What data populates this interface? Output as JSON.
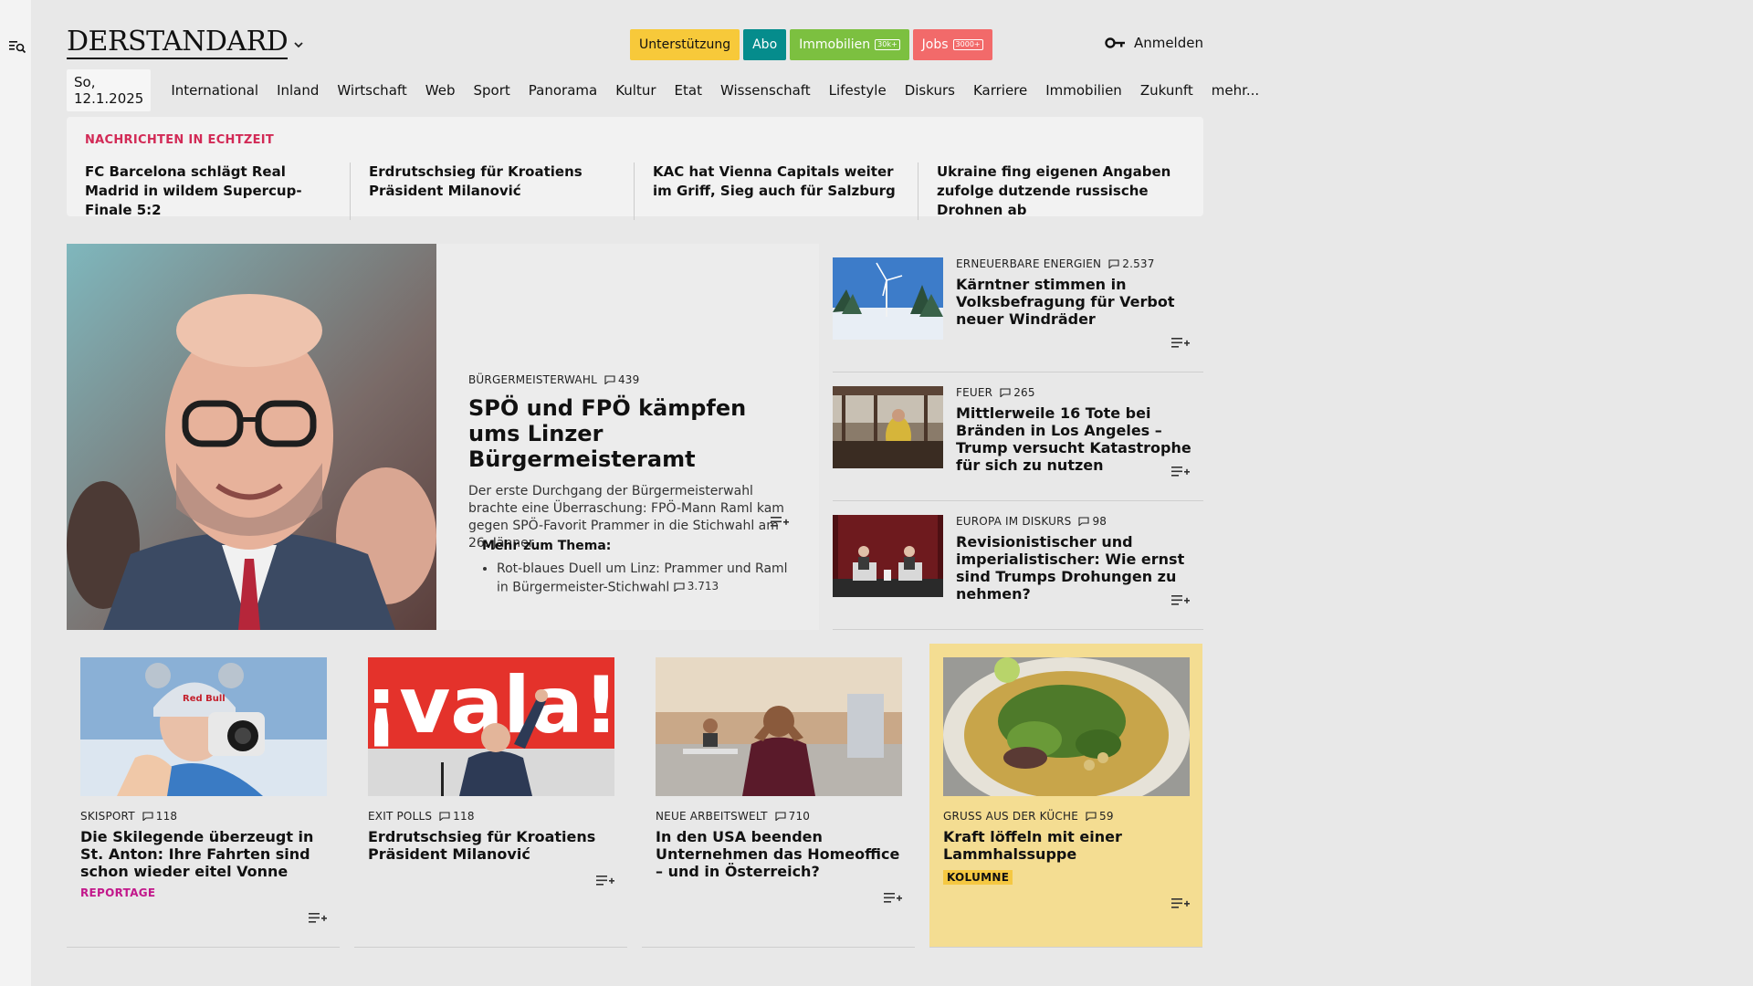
{
  "header": {
    "logo": "DERSTANDARD",
    "buttons": {
      "support": "Unterstützung",
      "abo": "Abo",
      "immobilien": "Immobilien",
      "immobilien_badge": "30k+",
      "jobs": "Jobs",
      "jobs_badge": "3000+"
    },
    "login": "Anmelden"
  },
  "nav": {
    "date": "So, 12.1.2025",
    "items": [
      "International",
      "Inland",
      "Wirtschaft",
      "Web",
      "Sport",
      "Panorama",
      "Kultur",
      "Etat",
      "Wissenschaft",
      "Lifestyle",
      "Diskurs",
      "Karriere",
      "Immobilien",
      "Zukunft",
      "mehr..."
    ]
  },
  "ticker": {
    "title": "NACHRICHTEN IN ECHTZEIT",
    "items": [
      "FC Barcelona schlägt Real Madrid in wildem Supercup-Finale 5:2",
      "Erdrutschsieg für Kroatiens Präsident Milanović",
      "KAC hat Vienna Capitals weiter im Griff, Sieg auch für Salzburg",
      "Ukraine fing eigenen Angaben zufolge dutzende russische Drohnen ab"
    ]
  },
  "lead": {
    "kicker": "Bürgermeisterwahl",
    "comments": "439",
    "title": "SPÖ und FPÖ kämpfen ums Linzer Bürgermeisteramt",
    "teaser": "Der erste Durchgang der Bürgermeisterwahl brachte eine Überraschung: FPÖ-Mann Raml kam gegen SPÖ-Favorit Prammer in die Stichwahl am 26. Jänner",
    "more_title": "Mehr zum Thema:",
    "more_item": "Rot-blaues Duell um Linz: Prammer und Raml in Bürgermeister-Stichwahl",
    "more_comments": "3.713"
  },
  "side": [
    {
      "kicker": "Erneuerbare Energien",
      "comments": "2.537",
      "title": "Kärntner stimmen in Volksbefragung für Verbot neuer Windräder"
    },
    {
      "kicker": "Feuer",
      "comments": "265",
      "title": "Mittlerweile 16 Tote bei Bränden in Los Angeles – Trump versucht Katastrophe für sich zu nutzen"
    },
    {
      "kicker": "Europa im Diskurs",
      "comments": "98",
      "title": "Revisionistischer und imperialis­tischer: Wie ernst sind Trumps Drohungen zu nehmen?"
    }
  ],
  "cards": [
    {
      "kicker": "Skisport",
      "comments": "118",
      "title": "Die Skilegende überzeugt in St. Anton: Ihre Fahrten sind schon wieder eitel Vonne",
      "tag": "REPORTAGE"
    },
    {
      "kicker": "Exit Polls",
      "comments": "118",
      "title": "Erdrutschsieg für Kroatiens Präsident Milanović",
      "img_text": "¡vala!"
    },
    {
      "kicker": "Neue Arbeitswelt",
      "comments": "710",
      "title": "In den USA beenden Unternehmen das Homeoffice – und in Österreich?"
    },
    {
      "kicker": "Gruss aus der Küche",
      "comments": "59",
      "title": "Kraft löffeln mit einer Lammhalssuppe",
      "tag": "KOLUMNE"
    }
  ]
}
